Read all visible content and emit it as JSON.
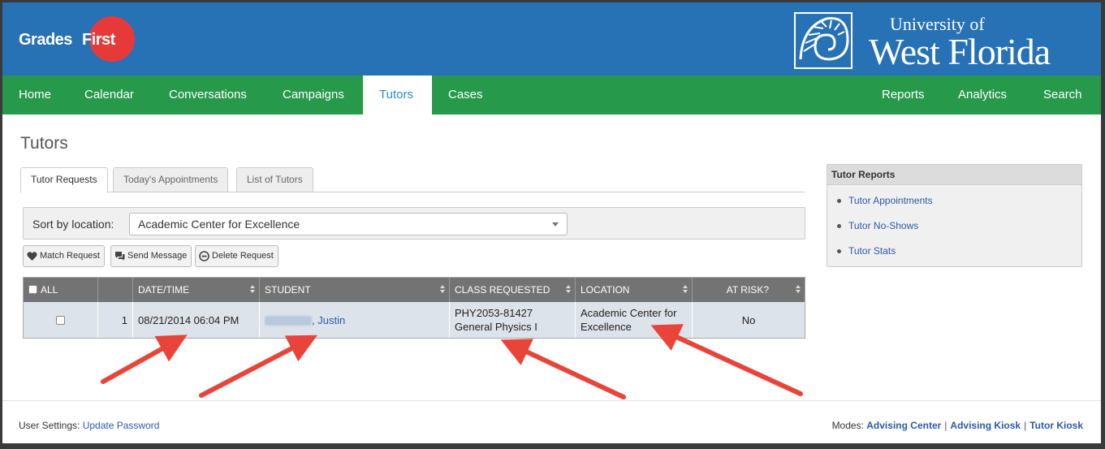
{
  "brand": {
    "logo_left": "Grades",
    "logo_right": "First",
    "university_line1": "University of",
    "university_line2": "West Florida"
  },
  "nav": {
    "left": [
      "Home",
      "Calendar",
      "Conversations",
      "Campaigns",
      "Tutors",
      "Cases"
    ],
    "right": [
      "Reports",
      "Analytics",
      "Search"
    ],
    "active": "Tutors"
  },
  "page": {
    "title": "Tutors"
  },
  "tabs": [
    "Tutor Requests",
    "Today's Appointments",
    "List of Tutors"
  ],
  "sort": {
    "label": "Sort by location:",
    "selected": "Academic Center for Excellence"
  },
  "actions": [
    "Match Request",
    "Send Message",
    "Delete Request"
  ],
  "table": {
    "columns": [
      "ALL",
      "DATE/TIME",
      "STUDENT",
      "CLASS REQUESTED",
      "LOCATION",
      "AT RISK?"
    ],
    "rows": [
      {
        "index": "1",
        "datetime": "08/21/2014 06:04 PM",
        "student_suffix": ", Justin",
        "class_line1": "PHY2053-81427",
        "class_line2": "General Physics I",
        "location_line1": "Academic Center for",
        "location_line2": "Excellence",
        "at_risk": "No"
      }
    ]
  },
  "side_panel": {
    "title": "Tutor Reports",
    "items": [
      "Tutor Appointments",
      "Tutor No-Shows",
      "Tutor Stats"
    ]
  },
  "footer": {
    "settings_label": "User Settings:",
    "settings_link": "Update Password",
    "modes_label": "Modes:",
    "modes": [
      "Advising Center",
      "Advising Kiosk",
      "Tutor Kiosk"
    ]
  },
  "colors": {
    "header": "#2771b5",
    "nav": "#27994a",
    "logo_circle": "#e63a3a",
    "arrow": "#e8443a",
    "link": "#2b5aa8"
  }
}
